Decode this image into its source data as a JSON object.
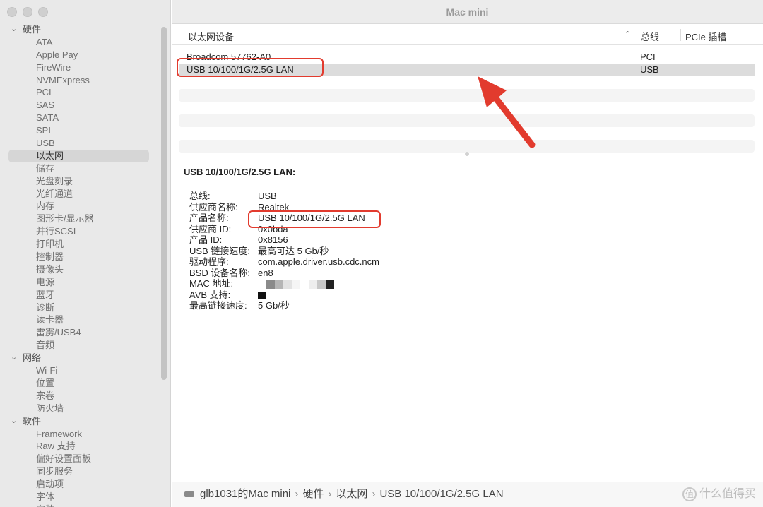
{
  "window": {
    "title": "Mac mini"
  },
  "sidebar": {
    "groups": [
      {
        "label": "硬件",
        "items": [
          "ATA",
          "Apple Pay",
          "FireWire",
          "NVMExpress",
          "PCI",
          "SAS",
          "SATA",
          "SPI",
          "USB",
          "以太网",
          "储存",
          "光盘刻录",
          "光纤通道",
          "内存",
          "图形卡/显示器",
          "并行SCSI",
          "打印机",
          "控制器",
          "摄像头",
          "电源",
          "蓝牙",
          "诊断",
          "读卡器",
          "雷雳/USB4",
          "音频"
        ]
      },
      {
        "label": "网络",
        "items": [
          "Wi-Fi",
          "位置",
          "宗卷",
          "防火墙"
        ]
      },
      {
        "label": "软件",
        "items": [
          "Framework",
          "Raw 支持",
          "偏好设置面板",
          "同步服务",
          "启动项",
          "字体",
          "安装"
        ]
      }
    ],
    "selected": "以太网"
  },
  "table": {
    "headers": {
      "name": "以太网设备",
      "bus": "总线",
      "slot": "PCIe 插槽"
    },
    "rows": [
      {
        "name": "Broadcom 57762-A0",
        "bus": "PCI",
        "selected": false
      },
      {
        "name": "USB 10/100/1G/2.5G LAN",
        "bus": "USB",
        "selected": true
      }
    ]
  },
  "detail": {
    "title": "USB 10/100/1G/2.5G LAN:",
    "fields": [
      {
        "key": "总线:",
        "value": "USB"
      },
      {
        "key": "供应商名称:",
        "value": "Realtek"
      },
      {
        "key": "产品名称:",
        "value": "USB 10/100/1G/2.5G LAN"
      },
      {
        "key": "供应商 ID:",
        "value": "0x0bda"
      },
      {
        "key": "产品 ID:",
        "value": "0x8156"
      },
      {
        "key": "USB 链接速度:",
        "value": "最高可达 5 Gb/秒"
      },
      {
        "key": "驱动程序:",
        "value": "com.apple.driver.usb.cdc.ncm"
      },
      {
        "key": "BSD 设备名称:",
        "value": "en8"
      },
      {
        "key": "MAC 地址:",
        "value": ""
      },
      {
        "key": "AVB 支持:",
        "value": ""
      },
      {
        "key": "最高链接速度:",
        "value": "5 Gb/秒"
      }
    ]
  },
  "pathbar": {
    "segments": [
      "glb1031的Mac mini",
      "硬件",
      "以太网",
      "USB 10/100/1G/2.5G LAN"
    ],
    "separator": "›"
  },
  "watermark": {
    "text": "什么值得买",
    "logo": "值"
  },
  "colors": {
    "highlight": "#e23b2e",
    "sidebar_bg": "#e9e9e9",
    "selected_row": "#dcdcdc"
  }
}
